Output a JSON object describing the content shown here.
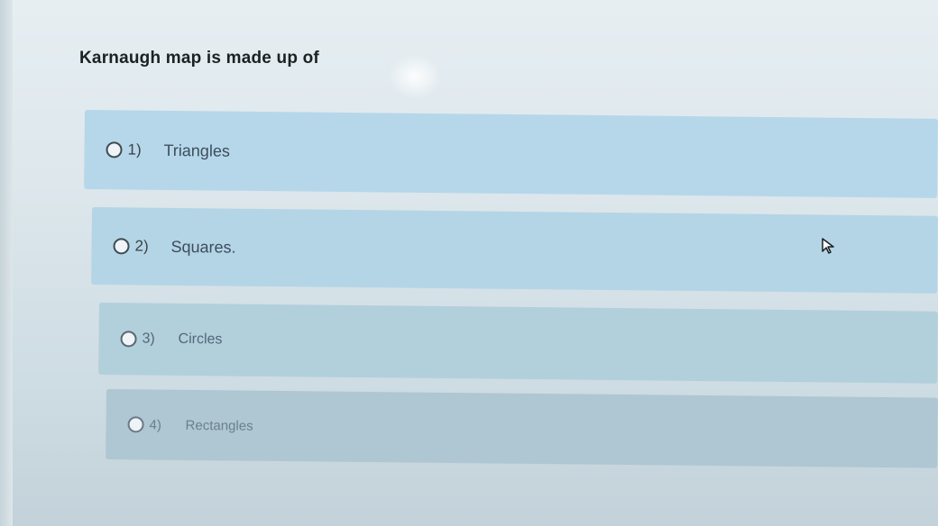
{
  "question": {
    "text": "Karnaugh map is made up of"
  },
  "options": [
    {
      "number": "1)",
      "label": "Triangles"
    },
    {
      "number": "2)",
      "label": "Squares."
    },
    {
      "number": "3)",
      "label": "Circles"
    },
    {
      "number": "4)",
      "label": "Rectangles"
    }
  ],
  "colors": {
    "option_background": "#b6d7ea",
    "page_background": "#e6eef2",
    "question_text": "#1c2124"
  },
  "icons": {
    "radio": "radio-button-icon",
    "cursor": "mouse-pointer-icon"
  }
}
